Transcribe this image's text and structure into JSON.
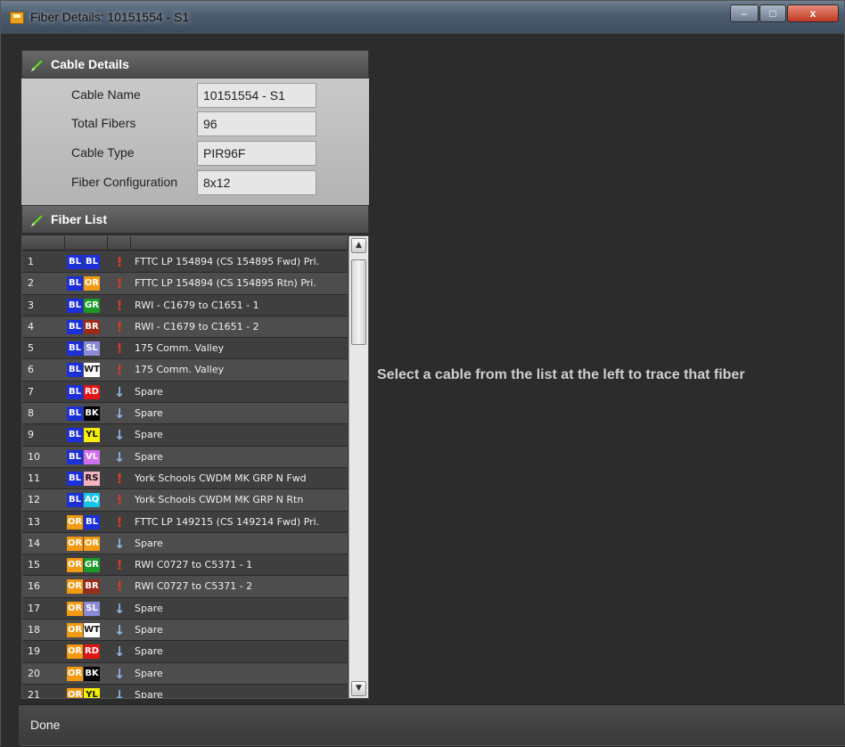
{
  "window": {
    "title": "Fiber Details: 10151554 - S1",
    "min_label": "–",
    "max_label": "□",
    "close_label": "x"
  },
  "cable_details": {
    "header": "Cable Details",
    "fields": [
      {
        "label": "Cable Name",
        "value": "10151554 - S1"
      },
      {
        "label": "Total Fibers",
        "value": "96"
      },
      {
        "label": "Cable Type",
        "value": "PIR96F"
      },
      {
        "label": "Fiber Configuration",
        "value": "8x12"
      }
    ]
  },
  "fiber_list": {
    "header": "Fiber List",
    "rows": [
      {
        "num": "1",
        "tube": "BL",
        "fiber": "BL",
        "icon": "pin-icon",
        "desc": "FTTC LP 154894 (CS 154895 Fwd) Pri."
      },
      {
        "num": "2",
        "tube": "BL",
        "fiber": "OR",
        "icon": "pin-icon",
        "desc": "FTTC LP 154894 (CS 154895 Rtn) Pri."
      },
      {
        "num": "3",
        "tube": "BL",
        "fiber": "GR",
        "icon": "pin-icon",
        "desc": "RWI - C1679 to C1651 - 1"
      },
      {
        "num": "4",
        "tube": "BL",
        "fiber": "BR",
        "icon": "pin-icon",
        "desc": "RWI - C1679 to C1651 - 2"
      },
      {
        "num": "5",
        "tube": "BL",
        "fiber": "SL",
        "icon": "pin-icon",
        "desc": "175 Comm. Valley"
      },
      {
        "num": "6",
        "tube": "BL",
        "fiber": "WT",
        "icon": "pin-icon",
        "desc": "175 Comm. Valley"
      },
      {
        "num": "7",
        "tube": "BL",
        "fiber": "RD",
        "icon": "down-arrow-icon",
        "desc": "Spare"
      },
      {
        "num": "8",
        "tube": "BL",
        "fiber": "BK",
        "icon": "down-arrow-icon",
        "desc": "Spare"
      },
      {
        "num": "9",
        "tube": "BL",
        "fiber": "YL",
        "icon": "down-arrow-icon",
        "desc": "Spare"
      },
      {
        "num": "10",
        "tube": "BL",
        "fiber": "VL",
        "icon": "down-arrow-icon",
        "desc": "Spare"
      },
      {
        "num": "11",
        "tube": "BL",
        "fiber": "RS",
        "icon": "pin-icon",
        "desc": "York Schools CWDM MK GRP N Fwd"
      },
      {
        "num": "12",
        "tube": "BL",
        "fiber": "AQ",
        "icon": "pin-icon",
        "desc": "York Schools CWDM MK GRP N Rtn"
      },
      {
        "num": "13",
        "tube": "OR",
        "fiber": "BL",
        "icon": "pin-icon",
        "desc": "FTTC LP 149215 (CS 149214 Fwd) Pri."
      },
      {
        "num": "14",
        "tube": "OR",
        "fiber": "OR",
        "icon": "down-arrow-icon",
        "desc": "Spare"
      },
      {
        "num": "15",
        "tube": "OR",
        "fiber": "GR",
        "icon": "pin-icon",
        "desc": "RWI C0727 to C5371 - 1"
      },
      {
        "num": "16",
        "tube": "OR",
        "fiber": "BR",
        "icon": "pin-icon",
        "desc": "RWI C0727 to C5371 - 2"
      },
      {
        "num": "17",
        "tube": "OR",
        "fiber": "SL",
        "icon": "down-arrow-icon",
        "desc": "Spare"
      },
      {
        "num": "18",
        "tube": "OR",
        "fiber": "WT",
        "icon": "down-arrow-icon",
        "desc": "Spare"
      },
      {
        "num": "19",
        "tube": "OR",
        "fiber": "RD",
        "icon": "down-arrow-icon",
        "desc": "Spare"
      },
      {
        "num": "20",
        "tube": "OR",
        "fiber": "BK",
        "icon": "down-arrow-icon",
        "desc": "Spare"
      },
      {
        "num": "21",
        "tube": "OR",
        "fiber": "YL",
        "icon": "down-arrow-icon",
        "desc": "Spare"
      }
    ]
  },
  "colors": {
    "BL": {
      "bg": "#1c2fd8",
      "fg": "#ffffff"
    },
    "OR": {
      "bg": "#f39a12",
      "fg": "#ffffff"
    },
    "GR": {
      "bg": "#1b9a2a",
      "fg": "#ffffff"
    },
    "BR": {
      "bg": "#9a2a1a",
      "fg": "#ffffff"
    },
    "SL": {
      "bg": "#8a8ad8",
      "fg": "#ffffff"
    },
    "WT": {
      "bg": "#ffffff",
      "fg": "#111111"
    },
    "RD": {
      "bg": "#e01515",
      "fg": "#ffffff"
    },
    "BK": {
      "bg": "#000000",
      "fg": "#ffffff"
    },
    "YL": {
      "bg": "#f5f000",
      "fg": "#111111"
    },
    "VL": {
      "bg": "#d070ee",
      "fg": "#ffffff"
    },
    "RS": {
      "bg": "#f2b4c0",
      "fg": "#111111"
    },
    "AQ": {
      "bg": "#15c4e8",
      "fg": "#ffffff"
    }
  },
  "icons": {
    "pin-icon": "!",
    "down-arrow-icon": "↓"
  },
  "message": "Select a cable from the list at the left to trace that fiber",
  "status": "Done"
}
